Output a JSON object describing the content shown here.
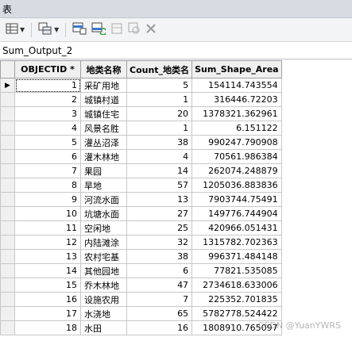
{
  "window": {
    "title": "表"
  },
  "toolbar": {
    "buttons": [
      {
        "icon": "table-options-icon",
        "has_dropdown": true
      },
      {
        "icon": "related-tables-icon",
        "has_dropdown": true
      },
      {
        "icon": "select-by-attributes-icon"
      },
      {
        "icon": "switch-selection-icon"
      },
      {
        "icon": "clear-selection-icon"
      },
      {
        "icon": "zoom-to-selected-icon"
      },
      {
        "icon": "delete-selected-icon"
      }
    ]
  },
  "tab": {
    "label": "Sum_Output_2"
  },
  "table": {
    "columns": [
      "OBJECTID *",
      "地类名称",
      "Count_地类名",
      "Sum_Shape_Area"
    ],
    "active_row_marker": "▶",
    "rows": [
      [
        "1",
        "采矿用地",
        "5",
        "154114.743554"
      ],
      [
        "2",
        "城镇村道",
        "1",
        "316446.72203"
      ],
      [
        "3",
        "城镇住宅",
        "20",
        "1378321.362961"
      ],
      [
        "4",
        "风景名胜",
        "1",
        "6.151122"
      ],
      [
        "5",
        "灌丛沼泽",
        "38",
        "990247.790908"
      ],
      [
        "6",
        "灌木林地",
        "4",
        "70561.986384"
      ],
      [
        "7",
        "果园",
        "14",
        "262074.248879"
      ],
      [
        "8",
        "旱地",
        "57",
        "1205036.883836"
      ],
      [
        "9",
        "河流水面",
        "13",
        "7903744.75491"
      ],
      [
        "10",
        "坑塘水面",
        "27",
        "149776.744904"
      ],
      [
        "11",
        "空闲地",
        "25",
        "420966.051431"
      ],
      [
        "12",
        "内陆滩涂",
        "32",
        "1315782.702363"
      ],
      [
        "13",
        "农村宅基",
        "38",
        "996371.484148"
      ],
      [
        "14",
        "其他园地",
        "6",
        "77821.535085"
      ],
      [
        "15",
        "乔木林地",
        "47",
        "2734618.633006"
      ],
      [
        "16",
        "设施农用",
        "7",
        "225352.701835"
      ],
      [
        "17",
        "水浇地",
        "65",
        "5782778.524422"
      ],
      [
        "18",
        "水田",
        "16",
        "1808910.765097"
      ]
    ]
  },
  "watermark": "CSDN @YuanYWRS"
}
